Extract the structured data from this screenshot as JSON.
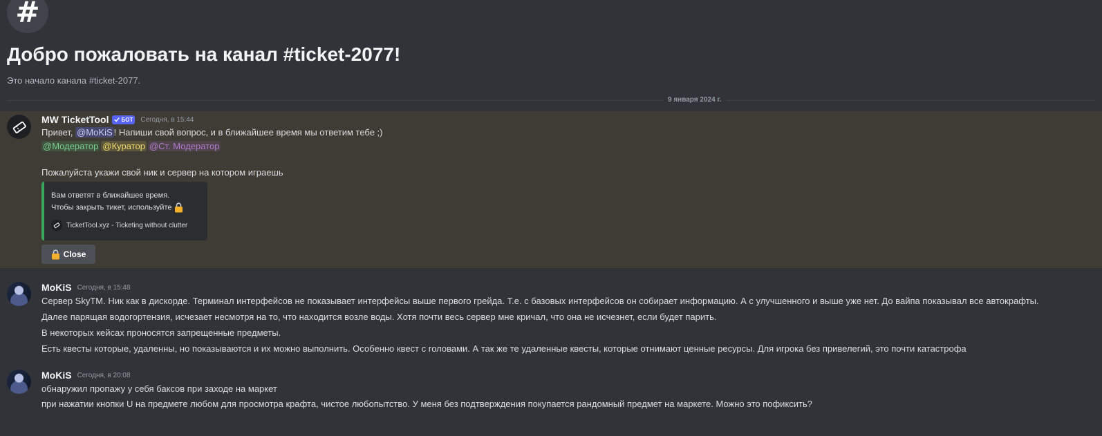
{
  "channel": {
    "hash_glyph": "#",
    "welcome_title": "Добро пожаловать на канал #ticket-2077!",
    "welcome_subtitle": "Это начало канала #ticket-2077.",
    "date_divider": "9 января 2024 г."
  },
  "messages": [
    {
      "author": "MW TicketTool",
      "bot_tag": "БОТ",
      "timestamp": "Сегодня, в 15:44",
      "line1_prefix": "Привет, ",
      "line1_mention": "@MoKiS",
      "line1_suffix": "! Напиши свой вопрос, и в ближайшее время мы ответим тебе ;)",
      "roles": [
        "@Модератор",
        "@Куратор",
        "@Ст. Модератор"
      ],
      "line3": "Пожалуйста укажи свой ник и сервер на котором играешь",
      "embed": {
        "line1": "Вам ответят в ближайшее время.",
        "line2": "Чтобы закрыть тикет, используйте",
        "footer": "TicketTool.xyz - Ticketing without clutter",
        "accent_color": "#3ba55d"
      },
      "button": {
        "label": "Close",
        "icon": "lock-icon"
      }
    },
    {
      "author": "MoKiS",
      "timestamp": "Сегодня, в 15:48",
      "lines": [
        "Сервер SkyTM. Ник как в дискорде. Терминал интерфейсов не показывает интерфейсы выше первого грейда. Т.е. с базовых интерфейсов он собирает информацию. А с улучшенного и выше уже нет. До вайпа показывал все автокрафты.",
        "Далее парящая водогортензия, исчезает несмотря на то, что находится возле воды. Хотя почти весь сервер мне кричал, что она не исчезнет, если будет парить.",
        "В некоторых кейсах проносятся запрещенные предметы.",
        "Есть квесты которые, удаленны, но показываются и их можно выполнить. Особенно квест с головами. А так же те удаленные квесты, которые отнимают ценные ресурсы. Для игрока без привелегий, это почти катастрофа"
      ]
    },
    {
      "author": "MoKiS",
      "timestamp": "Сегодня, в 20:08",
      "lines": [
        "обнаружил пропажу у себя баксов при заходе на маркет",
        "при нажатии кнопки U на предмете любом для просмотра крафта, чистое любопытство. У меня без подтверждения покупается рандомный предмет на маркете. Можно это пофиксить?"
      ]
    }
  ],
  "colors": {
    "background": "#313338",
    "highlight": "#3f3c35",
    "bot_tag": "#5865f2"
  }
}
